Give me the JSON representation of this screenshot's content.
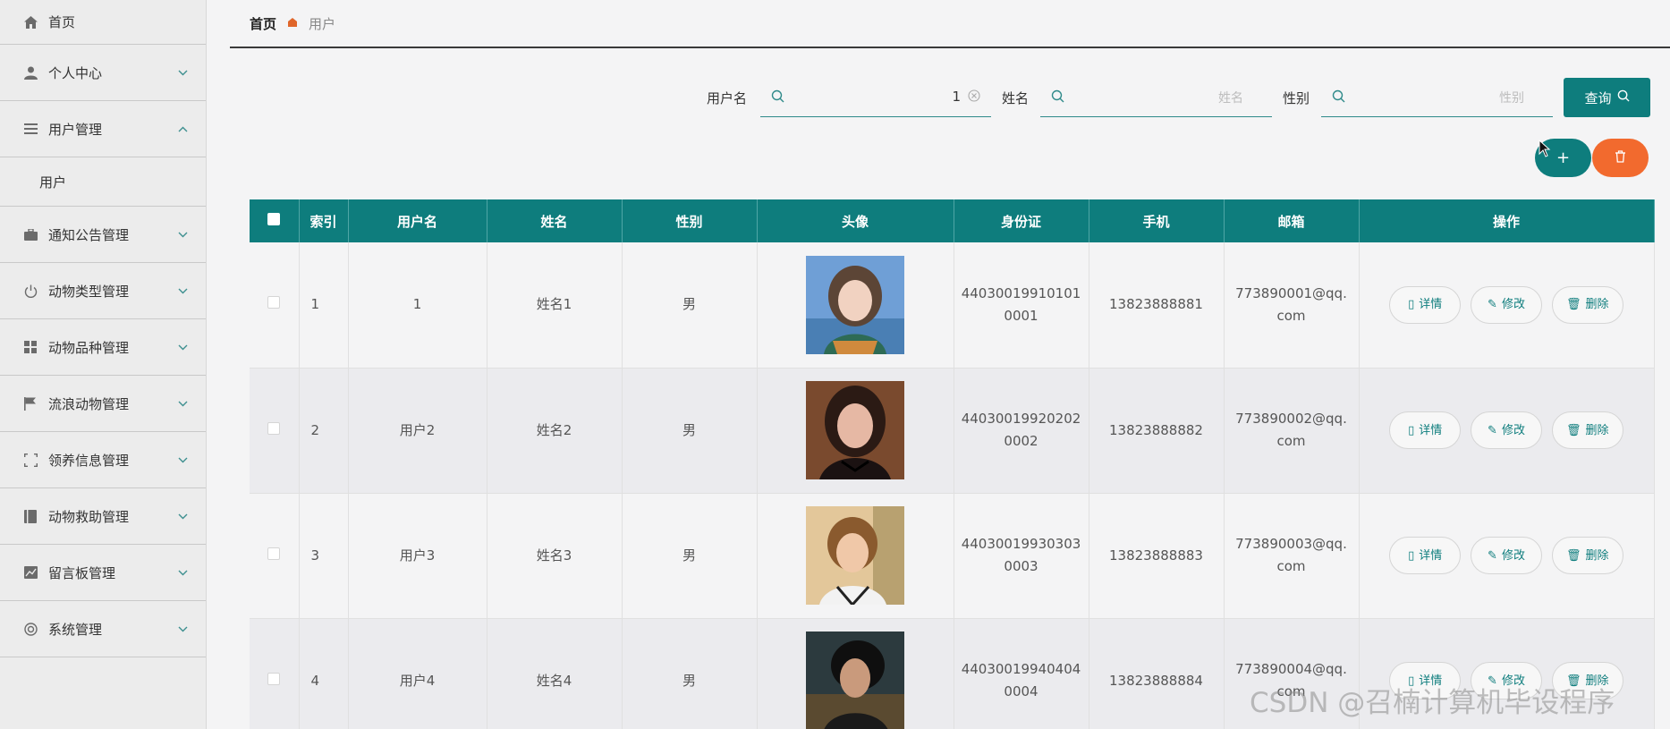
{
  "sidebar": {
    "items": [
      {
        "label": "首页",
        "icon": "home-icon"
      },
      {
        "label": "个人中心",
        "icon": "user-icon"
      },
      {
        "label": "用户管理",
        "icon": "list-icon",
        "expanded": true,
        "children": [
          {
            "label": "用户"
          }
        ]
      },
      {
        "label": "通知公告管理",
        "icon": "briefcase-icon"
      },
      {
        "label": "动物类型管理",
        "icon": "power-icon"
      },
      {
        "label": "动物品种管理",
        "icon": "grid-icon"
      },
      {
        "label": "流浪动物管理",
        "icon": "flag-icon"
      },
      {
        "label": "领养信息管理",
        "icon": "frame-icon"
      },
      {
        "label": "动物救助管理",
        "icon": "book-icon"
      },
      {
        "label": "留言板管理",
        "icon": "chart-icon"
      },
      {
        "label": "系统管理",
        "icon": "lifebuoy-icon"
      }
    ]
  },
  "breadcrumb": {
    "home": "首页",
    "current": "用户"
  },
  "search": {
    "username_label": "用户名",
    "username_value": "1",
    "name_label": "姓名",
    "name_placeholder": "姓名",
    "gender_label": "性别",
    "gender_placeholder": "性别",
    "query_label": "查询"
  },
  "actions": {
    "add_label": "+"
  },
  "table": {
    "headers": [
      "索引",
      "用户名",
      "姓名",
      "性别",
      "头像",
      "身份证",
      "手机",
      "邮箱",
      "操作"
    ],
    "rows": [
      {
        "index": "1",
        "username": "1",
        "name": "姓名1",
        "gender": "男",
        "id_card_1": "44030019910101",
        "id_card_2": "0001",
        "phone": "13823888881",
        "email_1": "773890001@qq.",
        "email_2": "com"
      },
      {
        "index": "2",
        "username": "用户2",
        "name": "姓名2",
        "gender": "男",
        "id_card_1": "44030019920202",
        "id_card_2": "0002",
        "phone": "13823888882",
        "email_1": "773890002@qq.",
        "email_2": "com"
      },
      {
        "index": "3",
        "username": "用户3",
        "name": "姓名3",
        "gender": "男",
        "id_card_1": "44030019930303",
        "id_card_2": "0003",
        "phone": "13823888883",
        "email_1": "773890003@qq.",
        "email_2": "com"
      },
      {
        "index": "4",
        "username": "用户4",
        "name": "姓名4",
        "gender": "男",
        "id_card_1": "44030019940404",
        "id_card_2": "0004",
        "phone": "13823888884",
        "email_1": "773890004@qq.",
        "email_2": "com"
      }
    ],
    "op_detail": "详情",
    "op_edit": "修改",
    "op_delete": "删除"
  },
  "watermark": "CSDN @召楠计算机毕设程序",
  "colors": {
    "primary": "#0e7d7d",
    "danger": "#f26a2e",
    "breadcrumb_sep": "#e0662a"
  }
}
